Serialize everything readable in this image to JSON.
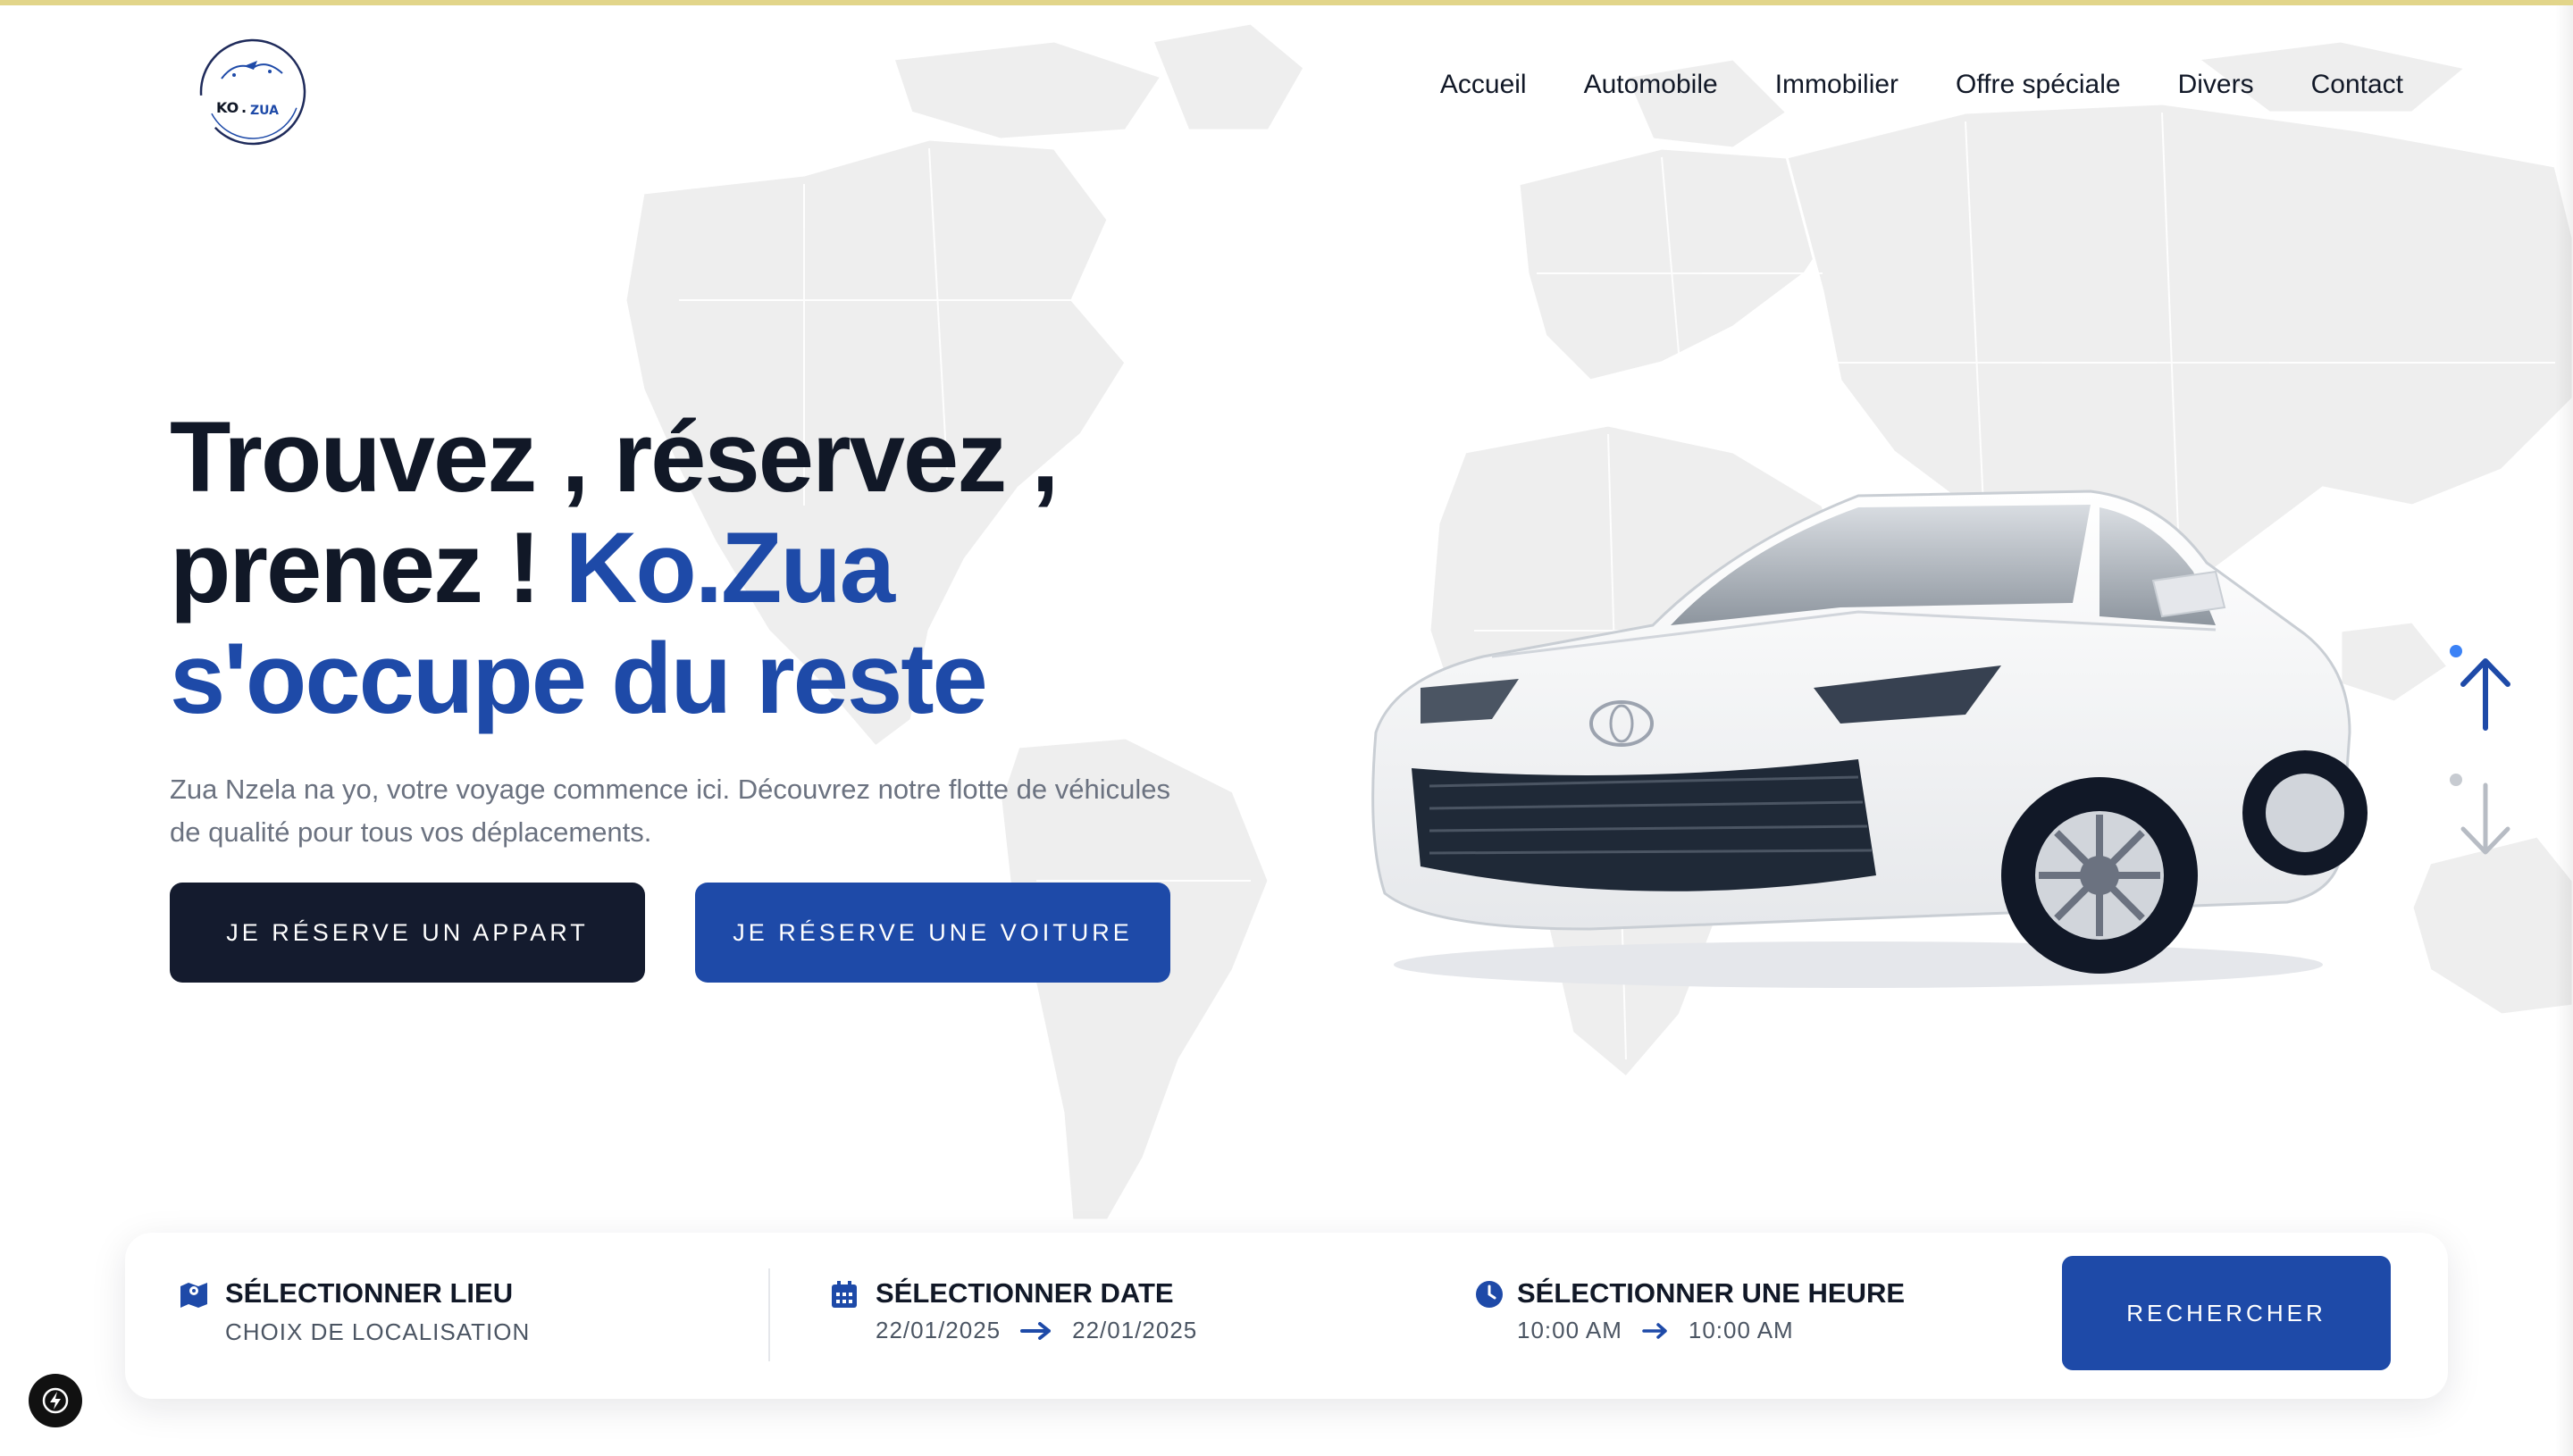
{
  "header": {
    "logo_text": "KO.ZUA",
    "nav": [
      "Accueil",
      "Automobile",
      "Immobilier",
      "Offre spéciale",
      "Divers",
      "Contact"
    ]
  },
  "hero": {
    "title_line1": "Trouvez , réservez ,",
    "title_line2_prefix": "prenez ! ",
    "title_line2_accent": "Ko.Zua",
    "title_line3_accent": "s'occupe du reste",
    "subtitle": "Zua Nzela na yo, votre voyage commence ici. Découvrez notre flotte de véhicules de qualité pour tous vos déplacements.",
    "btn_apart": "JE RÉSERVE UN APPART",
    "btn_car": "JE RÉSERVE UNE VOITURE"
  },
  "slider": {
    "up_icon": "arrow-up-icon",
    "down_icon": "arrow-down-icon"
  },
  "search": {
    "location_title": "SÉLECTIONNER LIEU",
    "location_sub": "CHOIX DE LOCALISATION",
    "date_title": "SÉLECTIONNER DATE",
    "date_from": "22/01/2025",
    "date_to": "22/01/2025",
    "time_title": "SÉLECTIONNER UNE HEURE",
    "time_from": "10:00 AM",
    "time_to": "10:00 AM",
    "button": "RECHERCHER"
  },
  "colors": {
    "accent": "#1e4aa8",
    "dark": "#141b2e",
    "muted": "#6b7280",
    "top_strip": "#e2d58a"
  }
}
